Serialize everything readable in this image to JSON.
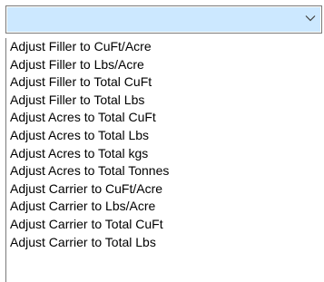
{
  "combo": {
    "selected_value": "",
    "arrow_icon": "chevron-down-icon",
    "highlight_color": "#cce8ff",
    "border_color": "#7a7a7a"
  },
  "list": {
    "items": [
      {
        "label": "Adjust Filler to CuFt/Acre"
      },
      {
        "label": "Adjust Filler to Lbs/Acre"
      },
      {
        "label": "Adjust Filler to Total CuFt"
      },
      {
        "label": "Adjust Filler to Total Lbs"
      },
      {
        "label": "Adjust Acres to Total CuFt"
      },
      {
        "label": "Adjust Acres to Total Lbs"
      },
      {
        "label": "Adjust Acres to Total kgs"
      },
      {
        "label": "Adjust Acres to Total Tonnes"
      },
      {
        "label": "Adjust Carrier to CuFt/Acre"
      },
      {
        "label": "Adjust Carrier to Lbs/Acre"
      },
      {
        "label": "Adjust Carrier to Total CuFt"
      },
      {
        "label": "Adjust Carrier to Total Lbs"
      }
    ]
  }
}
